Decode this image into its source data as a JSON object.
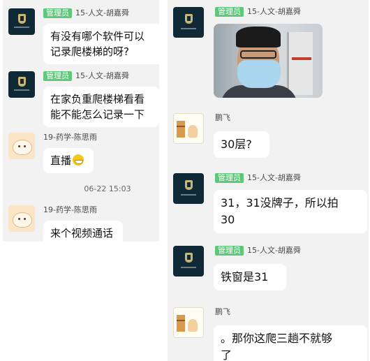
{
  "badge_label": "管理员",
  "senders": {
    "admin": "15-人文-胡嘉舜",
    "student": "19-药学-陈思雨",
    "pengfei": "鹏飞"
  },
  "left_panel": {
    "messages": [
      {
        "text_line1": "有没有哪个软件可以",
        "text_line2": "记录爬楼梯的呀?"
      },
      {
        "text_line1": "在家负重爬楼梯看看",
        "text_line2": "能不能怎么记录一下"
      },
      {
        "text": "直播",
        "emoji": "grin-emoji"
      },
      {
        "text": "来个视频通话"
      }
    ],
    "timestamp": "06-22 15:03"
  },
  "right_panel": {
    "messages": [
      {
        "text": "30层?"
      },
      {
        "text_line1": "31，31没牌子，所以拍",
        "text_line2": "30"
      },
      {
        "text": "铁窗是31"
      },
      {
        "text_line1": "。那你这爬三趟不就够",
        "text_line2": "了"
      }
    ]
  },
  "colors": {
    "badge": "#5ec77a",
    "panel_bg": "#f2f2f2",
    "bubble_bg": "#ffffff"
  }
}
